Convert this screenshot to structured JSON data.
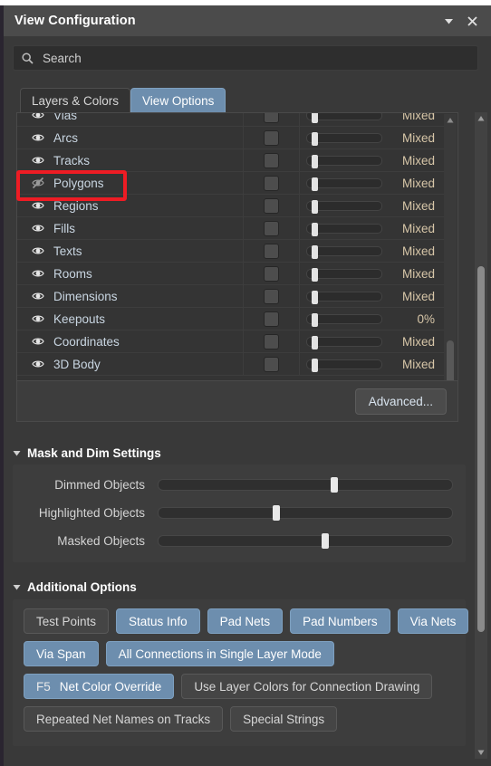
{
  "window": {
    "title": "View Configuration",
    "collapse_icon": "chevron-down-icon",
    "close_icon": "close-icon"
  },
  "search": {
    "icon": "search-icon",
    "placeholder": "Search",
    "value": ""
  },
  "tabs": [
    {
      "label": "Layers & Colors",
      "active": false
    },
    {
      "label": "View Options",
      "active": true
    }
  ],
  "object_list": {
    "rows": [
      {
        "label": "Vias",
        "visible": true,
        "checked": false,
        "slider": 6,
        "value": "Mixed"
      },
      {
        "label": "Arcs",
        "visible": true,
        "checked": false,
        "slider": 6,
        "value": "Mixed"
      },
      {
        "label": "Tracks",
        "visible": true,
        "checked": false,
        "slider": 6,
        "value": "Mixed"
      },
      {
        "label": "Polygons",
        "visible": false,
        "checked": false,
        "slider": 6,
        "value": "Mixed"
      },
      {
        "label": "Regions",
        "visible": true,
        "checked": false,
        "slider": 6,
        "value": "Mixed"
      },
      {
        "label": "Fills",
        "visible": true,
        "checked": false,
        "slider": 6,
        "value": "Mixed"
      },
      {
        "label": "Texts",
        "visible": true,
        "checked": false,
        "slider": 6,
        "value": "Mixed"
      },
      {
        "label": "Rooms",
        "visible": true,
        "checked": false,
        "slider": 6,
        "value": "Mixed"
      },
      {
        "label": "Dimensions",
        "visible": true,
        "checked": false,
        "slider": 6,
        "value": "Mixed"
      },
      {
        "label": "Keepouts",
        "visible": true,
        "checked": false,
        "slider": 6,
        "value": "0%"
      },
      {
        "label": "Coordinates",
        "visible": true,
        "checked": false,
        "slider": 6,
        "value": "Mixed"
      },
      {
        "label": "3D Body",
        "visible": true,
        "checked": false,
        "slider": 6,
        "value": "Mixed"
      }
    ],
    "advanced_label": "Advanced..."
  },
  "mask_dim": {
    "title": "Mask and Dim Settings",
    "sliders": [
      {
        "label": "Dimmed Objects",
        "percent": 60
      },
      {
        "label": "Highlighted Objects",
        "percent": 40
      },
      {
        "label": "Masked Objects",
        "percent": 57
      }
    ]
  },
  "additional_options": {
    "title": "Additional Options",
    "rows": [
      [
        {
          "label": "Test Points",
          "on": false
        },
        {
          "label": "Status Info",
          "on": true
        },
        {
          "label": "Pad Nets",
          "on": true
        },
        {
          "label": "Pad Numbers",
          "on": true
        },
        {
          "label": "Via Nets",
          "on": true
        }
      ],
      [
        {
          "label": "Via Span",
          "on": true
        },
        {
          "label": "All Connections in Single Layer Mode",
          "on": true
        }
      ],
      [
        {
          "key": "F5",
          "label": "Net Color Override",
          "on": true
        },
        {
          "label": "Use Layer Colors for Connection Drawing",
          "on": false
        }
      ],
      [
        {
          "label": "Repeated Net Names on Tracks",
          "on": false
        },
        {
          "label": "Special Strings",
          "on": false
        }
      ]
    ]
  },
  "annotation": {
    "target": "Polygons",
    "color": "#ee1c24"
  },
  "colors": {
    "accent_blue": "#6d8eae",
    "panel_bg": "#393939",
    "group_bg": "#3d3d3d",
    "list_bg": "#343434",
    "value_text": "#d7c6a8",
    "label_text": "#c9d6e2"
  }
}
